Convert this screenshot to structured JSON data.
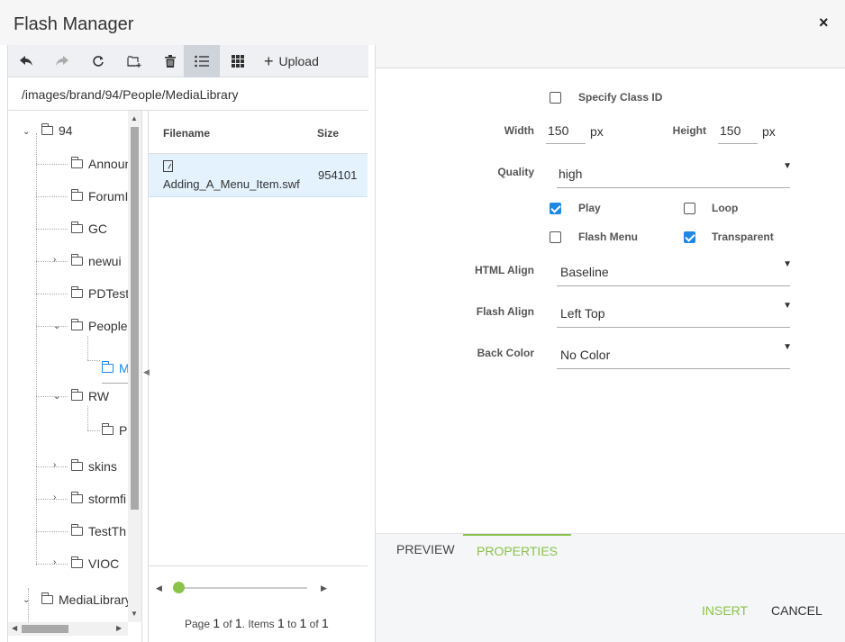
{
  "window": {
    "title": "Flash Manager",
    "close_icon": "×"
  },
  "toolbar": {
    "upload_label": "Upload"
  },
  "path": "/images/brand/94/People/MediaLibrary",
  "tree": {
    "nodes": [
      "94",
      "Announ",
      "ForumI",
      "GC",
      "newui",
      "PDTest",
      "People",
      "M",
      "RW",
      "Pa",
      "skins",
      "stormfi",
      "TestTh",
      "VIOC",
      "MediaLibrary"
    ]
  },
  "grid": {
    "columns": {
      "filename": "Filename",
      "size": "Size"
    },
    "rows": [
      {
        "filename": "Adding_A_Menu_Item.swf",
        "size": "954101"
      }
    ],
    "pager": {
      "text_page": "Page",
      "page": "1",
      "text_of1": "of",
      "pages": "1",
      "text_items": ". Items",
      "from": "1",
      "text_to": "to",
      "to": "1",
      "text_of2": "of",
      "total": "1"
    }
  },
  "properties": {
    "specify_class_id_label": "Specify Class ID",
    "width_label": "Width",
    "width_value": "150",
    "height_label": "Height",
    "height_value": "150",
    "unit": "px",
    "quality_label": "Quality",
    "quality_value": "high",
    "play_label": "Play",
    "loop_label": "Loop",
    "flash_menu_label": "Flash Menu",
    "transparent_label": "Transparent",
    "html_align_label": "HTML Align",
    "html_align_value": "Baseline",
    "flash_align_label": "Flash Align",
    "flash_align_value": "Left Top",
    "back_color_label": "Back Color",
    "back_color_value": "No Color"
  },
  "tabs": {
    "preview": "PREVIEW",
    "properties": "PROPERTIES"
  },
  "actions": {
    "insert": "INSERT",
    "cancel": "CANCEL"
  },
  "colors": {
    "accent_green": "#8bc34a",
    "accent_blue": "#1e88e5",
    "selected_row": "#e3f2fd"
  }
}
